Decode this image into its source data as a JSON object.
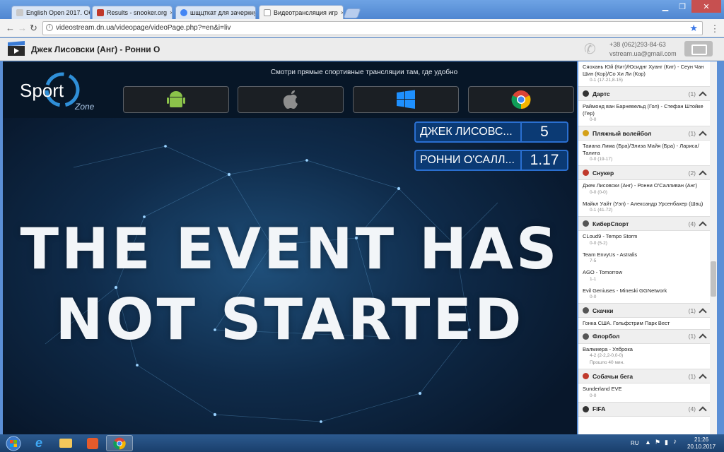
{
  "browser": {
    "tabs": [
      {
        "title": "English Open 2017. Обс",
        "color": "#c9c9c9"
      },
      {
        "title": "Results - snooker.org",
        "color": "#c0392b"
      },
      {
        "title": "шщцткат для зачеркну",
        "color": "#4285f4"
      },
      {
        "title": "Видеотрансляция игр",
        "color": "#e8e8e8"
      }
    ],
    "url": "videostream.dn.ua/videopage/videoPage.php?=en&i=liv"
  },
  "header": {
    "title": "Джек Лисовски (Анг) - Ронни О",
    "phone": "+38 (062)293-84-63",
    "email": "vstream.ua@gmail.com"
  },
  "promo": {
    "text": "Смотри прямые спортивные трансляции там, где удобно",
    "brand": "Sport",
    "brand_sub": "Zone"
  },
  "score": [
    {
      "name": "ДЖЕК ЛИСОВС...",
      "value": "5"
    },
    {
      "name": "РОННИ О'САЛЛ...",
      "value": "1.17"
    }
  ],
  "video": {
    "line1": "THE EVENT HAS",
    "line2": "NOT STARTED"
  },
  "sidebar": {
    "top_match": {
      "teams": "Сяохань Юй (Кит)/Юсиднг Хуанг (Кит) - Сеун Чан Шин (Кор)/Со Хи Ли (Кор)",
      "score": "0-1 (17-21,8-15)"
    },
    "categories": [
      {
        "name": "Дартс",
        "count": "(1)",
        "color": "#333",
        "matches": [
          {
            "teams": "Раймонд ван Барневельд (Гол) - Стефан Штойке (Гер)",
            "score": "0-0"
          }
        ]
      },
      {
        "name": "Пляжный волейбол",
        "count": "(1)",
        "color": "#d4a017",
        "matches": [
          {
            "teams": "Таиана Лима (Бра)/Элиза Майя (Бра) - Лариса/Талита",
            "score": "0-0 (19-17)"
          }
        ]
      },
      {
        "name": "Снукер",
        "count": "(2)",
        "color": "#c0392b",
        "matches": [
          {
            "teams": "Джек Лисовски (Анг) - Ронни О'Салливан (Анг)",
            "score": "0-0 (0-0)"
          },
          {
            "teams": "Майкл Уайт (Уэл) - Александр Урсенбахер (Швц)",
            "score": "0-1 (41-72)"
          }
        ]
      },
      {
        "name": "КиберСпорт",
        "count": "(4)",
        "color": "#555",
        "matches": [
          {
            "teams": "CLoud9 - Tempo Storm",
            "score": "0-0 (5-2)"
          },
          {
            "teams": "Team EnvyUs - Astralis",
            "score": "7-5"
          },
          {
            "teams": "AGO - Tomorrow",
            "score": "1-1"
          },
          {
            "teams": "Evil Geniuses - Mineski GGNetwork",
            "score": "0-0"
          }
        ]
      },
      {
        "name": "Скачки",
        "count": "(1)",
        "color": "#555",
        "matches": [
          {
            "teams": "Гонка США. Гольфстрим Парк Вест",
            "score": ""
          }
        ]
      },
      {
        "name": "Флорбол",
        "count": "(1)",
        "color": "#555",
        "matches": [
          {
            "teams": "Валмиера - Улброка",
            "score": "4-2 (2-2,2-0,0-0)",
            "extra": "Прошло 40 мин."
          }
        ]
      },
      {
        "name": "Собачьи бега",
        "count": "(1)",
        "color": "#c0392b",
        "matches": [
          {
            "teams": "Sunderland EVE",
            "score": "0-0"
          }
        ]
      },
      {
        "name": "FIFA",
        "count": "(4)",
        "color": "#333",
        "matches": []
      }
    ]
  },
  "taskbar": {
    "lang": "RU",
    "time": "21:26",
    "date": "20.10.2017"
  }
}
